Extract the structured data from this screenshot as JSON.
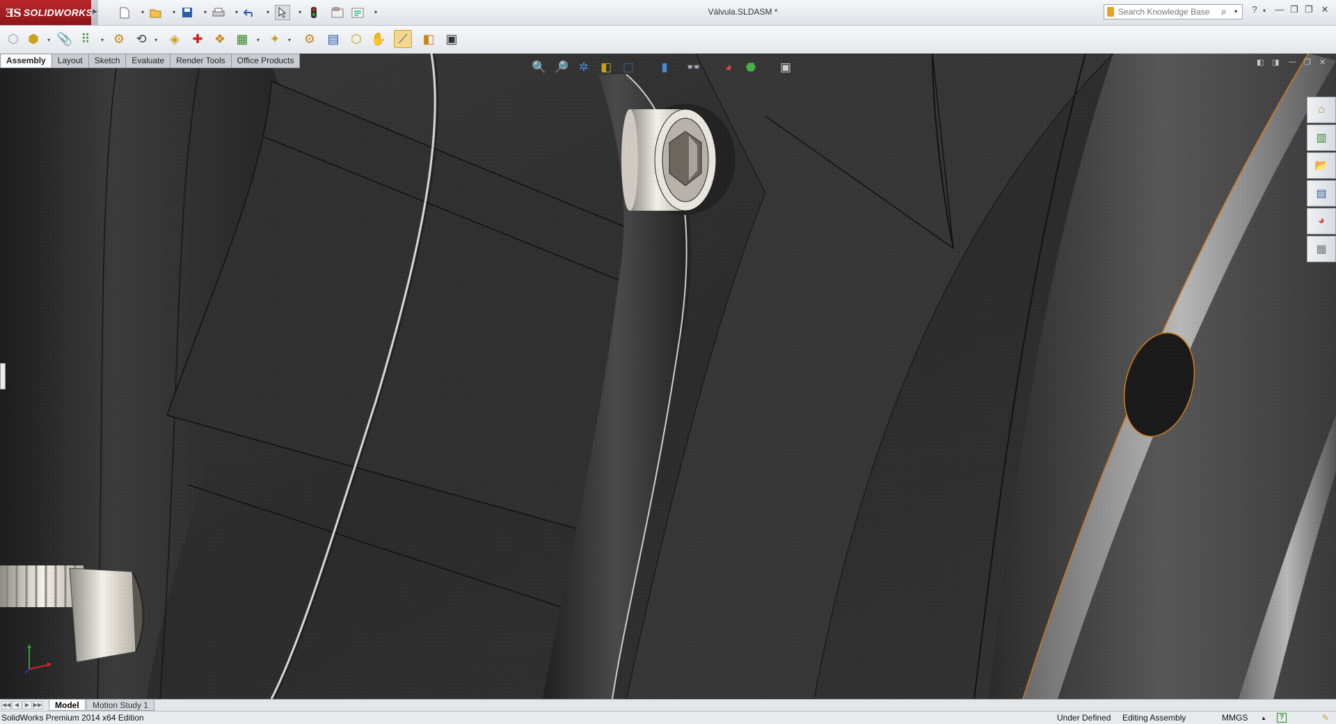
{
  "app": {
    "logo_mark": "ƎS",
    "logo_text": "SOLIDWORKS",
    "document_title": "Válvula.SLDASM *"
  },
  "search": {
    "placeholder": "Search Knowledge Base"
  },
  "quick_access": [
    "new-document-icon",
    "open-folder-icon",
    "save-icon",
    "print-icon",
    "undo-icon",
    "select-arrow-icon",
    "rebuild-icon",
    "file-properties-icon",
    "options-icon"
  ],
  "command_tabs": [
    {
      "label": "Assembly",
      "active": true
    },
    {
      "label": "Layout",
      "active": false
    },
    {
      "label": "Sketch",
      "active": false
    },
    {
      "label": "Evaluate",
      "active": false
    },
    {
      "label": "Render Tools",
      "active": false
    },
    {
      "label": "Office Products",
      "active": false
    }
  ],
  "bottom_tabs": [
    {
      "label": "Model",
      "active": true
    },
    {
      "label": "Motion Study 1",
      "active": false
    }
  ],
  "status": {
    "edition": "SolidWorks Premium 2014 x64 Edition",
    "definition": "Under Defined",
    "mode": "Editing Assembly",
    "units": "MMGS",
    "units_arrow": "▲"
  },
  "colors": {
    "brand_red": "#a01e22",
    "active_tool": "#f3d78a",
    "model_body": "#2f2f2f",
    "edge_highlight": "#d07a1e"
  }
}
